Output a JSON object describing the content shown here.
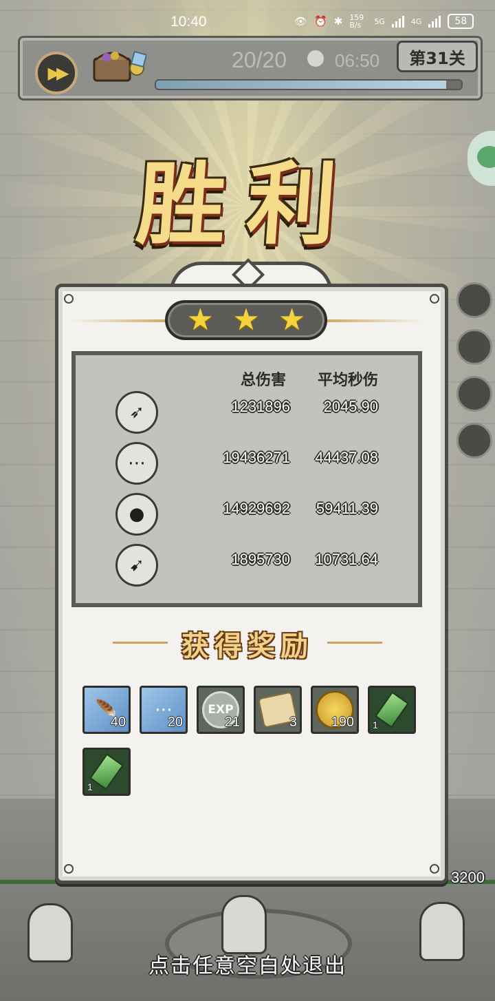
{
  "status_bar": {
    "time": "10:40",
    "net_speed": "159 B/s",
    "net_5g": "5G",
    "net_4g": "4G",
    "battery": "58"
  },
  "hud": {
    "wave": "20/20",
    "timer": "06:50",
    "level": "第31关",
    "energy_fill": 0.95
  },
  "title": "胜利",
  "stars": {
    "earned": 3,
    "total": 3
  },
  "stats": {
    "col_total": "总伤害",
    "col_dps": "平均秒伤",
    "rows": [
      {
        "icon": "triple-arrow-tower-icon",
        "total": "1231896",
        "dps": "2045.90"
      },
      {
        "icon": "spike-trap-tower-icon",
        "total": "19436271",
        "dps": "44437.08"
      },
      {
        "icon": "bomb-tower-icon",
        "total": "14929692",
        "dps": "59411.39"
      },
      {
        "icon": "arrow-volley-tower-icon",
        "total": "1895730",
        "dps": "10731.64"
      }
    ]
  },
  "rewards": {
    "title": "获得奖励",
    "items": [
      {
        "icon": "blue-feather-card-icon",
        "count": "40"
      },
      {
        "icon": "blue-spike-card-icon",
        "count": "20"
      },
      {
        "icon": "exp-coin-icon",
        "label": "EXP",
        "count": "21"
      },
      {
        "icon": "scroll-icon",
        "count": "3"
      },
      {
        "icon": "gold-coin-icon",
        "count": "190"
      },
      {
        "icon": "green-crystal-icon",
        "count": "1"
      },
      {
        "icon": "green-crystal-icon",
        "count": "1"
      }
    ]
  },
  "hp": "3200",
  "exit_hint": "点击任意空白处退出",
  "colors": {
    "gold": "#f4dc8a",
    "star": "#f5d13a",
    "panel": "#f3f2ee",
    "frame": "#4b4b47"
  }
}
